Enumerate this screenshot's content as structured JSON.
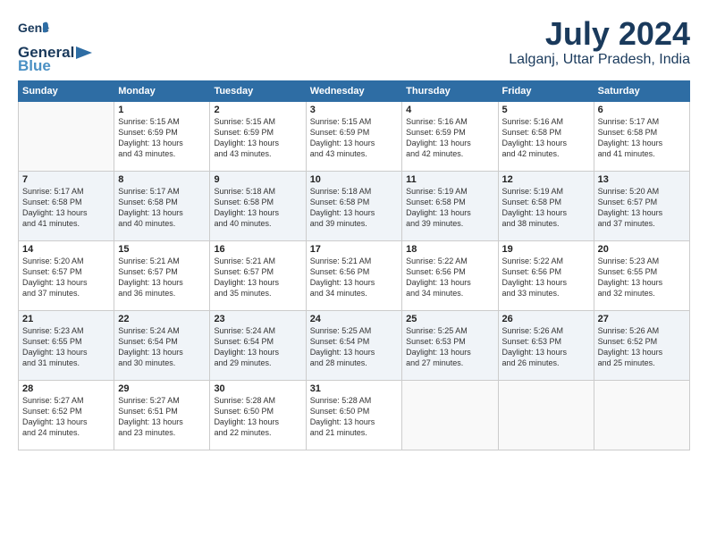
{
  "logo": {
    "general": "General",
    "blue": "Blue"
  },
  "title": {
    "month_year": "July 2024",
    "location": "Lalganj, Uttar Pradesh, India"
  },
  "columns": [
    "Sunday",
    "Monday",
    "Tuesday",
    "Wednesday",
    "Thursday",
    "Friday",
    "Saturday"
  ],
  "weeks": [
    [
      {
        "num": "",
        "info": ""
      },
      {
        "num": "1",
        "info": "Sunrise: 5:15 AM\nSunset: 6:59 PM\nDaylight: 13 hours\nand 43 minutes."
      },
      {
        "num": "2",
        "info": "Sunrise: 5:15 AM\nSunset: 6:59 PM\nDaylight: 13 hours\nand 43 minutes."
      },
      {
        "num": "3",
        "info": "Sunrise: 5:15 AM\nSunset: 6:59 PM\nDaylight: 13 hours\nand 43 minutes."
      },
      {
        "num": "4",
        "info": "Sunrise: 5:16 AM\nSunset: 6:59 PM\nDaylight: 13 hours\nand 42 minutes."
      },
      {
        "num": "5",
        "info": "Sunrise: 5:16 AM\nSunset: 6:58 PM\nDaylight: 13 hours\nand 42 minutes."
      },
      {
        "num": "6",
        "info": "Sunrise: 5:17 AM\nSunset: 6:58 PM\nDaylight: 13 hours\nand 41 minutes."
      }
    ],
    [
      {
        "num": "7",
        "info": "Sunrise: 5:17 AM\nSunset: 6:58 PM\nDaylight: 13 hours\nand 41 minutes."
      },
      {
        "num": "8",
        "info": "Sunrise: 5:17 AM\nSunset: 6:58 PM\nDaylight: 13 hours\nand 40 minutes."
      },
      {
        "num": "9",
        "info": "Sunrise: 5:18 AM\nSunset: 6:58 PM\nDaylight: 13 hours\nand 40 minutes."
      },
      {
        "num": "10",
        "info": "Sunrise: 5:18 AM\nSunset: 6:58 PM\nDaylight: 13 hours\nand 39 minutes."
      },
      {
        "num": "11",
        "info": "Sunrise: 5:19 AM\nSunset: 6:58 PM\nDaylight: 13 hours\nand 39 minutes."
      },
      {
        "num": "12",
        "info": "Sunrise: 5:19 AM\nSunset: 6:58 PM\nDaylight: 13 hours\nand 38 minutes."
      },
      {
        "num": "13",
        "info": "Sunrise: 5:20 AM\nSunset: 6:57 PM\nDaylight: 13 hours\nand 37 minutes."
      }
    ],
    [
      {
        "num": "14",
        "info": "Sunrise: 5:20 AM\nSunset: 6:57 PM\nDaylight: 13 hours\nand 37 minutes."
      },
      {
        "num": "15",
        "info": "Sunrise: 5:21 AM\nSunset: 6:57 PM\nDaylight: 13 hours\nand 36 minutes."
      },
      {
        "num": "16",
        "info": "Sunrise: 5:21 AM\nSunset: 6:57 PM\nDaylight: 13 hours\nand 35 minutes."
      },
      {
        "num": "17",
        "info": "Sunrise: 5:21 AM\nSunset: 6:56 PM\nDaylight: 13 hours\nand 34 minutes."
      },
      {
        "num": "18",
        "info": "Sunrise: 5:22 AM\nSunset: 6:56 PM\nDaylight: 13 hours\nand 34 minutes."
      },
      {
        "num": "19",
        "info": "Sunrise: 5:22 AM\nSunset: 6:56 PM\nDaylight: 13 hours\nand 33 minutes."
      },
      {
        "num": "20",
        "info": "Sunrise: 5:23 AM\nSunset: 6:55 PM\nDaylight: 13 hours\nand 32 minutes."
      }
    ],
    [
      {
        "num": "21",
        "info": "Sunrise: 5:23 AM\nSunset: 6:55 PM\nDaylight: 13 hours\nand 31 minutes."
      },
      {
        "num": "22",
        "info": "Sunrise: 5:24 AM\nSunset: 6:54 PM\nDaylight: 13 hours\nand 30 minutes."
      },
      {
        "num": "23",
        "info": "Sunrise: 5:24 AM\nSunset: 6:54 PM\nDaylight: 13 hours\nand 29 minutes."
      },
      {
        "num": "24",
        "info": "Sunrise: 5:25 AM\nSunset: 6:54 PM\nDaylight: 13 hours\nand 28 minutes."
      },
      {
        "num": "25",
        "info": "Sunrise: 5:25 AM\nSunset: 6:53 PM\nDaylight: 13 hours\nand 27 minutes."
      },
      {
        "num": "26",
        "info": "Sunrise: 5:26 AM\nSunset: 6:53 PM\nDaylight: 13 hours\nand 26 minutes."
      },
      {
        "num": "27",
        "info": "Sunrise: 5:26 AM\nSunset: 6:52 PM\nDaylight: 13 hours\nand 25 minutes."
      }
    ],
    [
      {
        "num": "28",
        "info": "Sunrise: 5:27 AM\nSunset: 6:52 PM\nDaylight: 13 hours\nand 24 minutes."
      },
      {
        "num": "29",
        "info": "Sunrise: 5:27 AM\nSunset: 6:51 PM\nDaylight: 13 hours\nand 23 minutes."
      },
      {
        "num": "30",
        "info": "Sunrise: 5:28 AM\nSunset: 6:50 PM\nDaylight: 13 hours\nand 22 minutes."
      },
      {
        "num": "31",
        "info": "Sunrise: 5:28 AM\nSunset: 6:50 PM\nDaylight: 13 hours\nand 21 minutes."
      },
      {
        "num": "",
        "info": ""
      },
      {
        "num": "",
        "info": ""
      },
      {
        "num": "",
        "info": ""
      }
    ]
  ]
}
